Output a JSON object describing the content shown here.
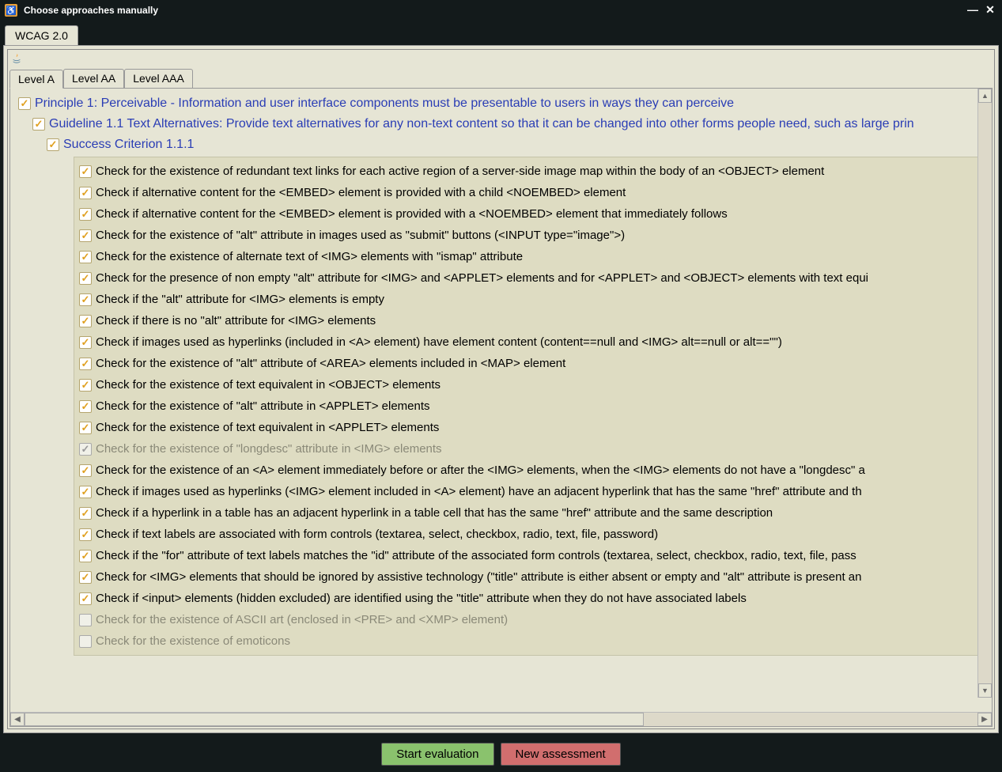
{
  "window": {
    "title": "Choose approaches manually"
  },
  "main_tabs": {
    "active": 0,
    "items": [
      "WCAG 2.0"
    ]
  },
  "level_tabs": {
    "active": 0,
    "items": [
      "Level A",
      "Level AA",
      "Level AAA"
    ]
  },
  "tree": {
    "principle": "Principle 1: Perceivable - Information and user interface components must be presentable to users in ways they can perceive",
    "guideline": "Guideline 1.1 Text Alternatives: Provide text alternatives for any non-text content so that it can be changed into other forms people need, such as large prin",
    "criterion": "Success Criterion 1.1.1",
    "checks": [
      {
        "label": "Check for the existence of redundant text links for each active region of a server-side image map within the body of an <OBJECT> element",
        "checked": true,
        "enabled": true
      },
      {
        "label": "Check if alternative content for the <EMBED> element is provided with a child <NOEMBED> element",
        "checked": true,
        "enabled": true
      },
      {
        "label": "Check if alternative content for the <EMBED> element is provided with a <NOEMBED> element that immediately follows",
        "checked": true,
        "enabled": true
      },
      {
        "label": "Check for the existence of \"alt\" attribute in images used as \"submit\" buttons (<INPUT type=\"image\">)",
        "checked": true,
        "enabled": true
      },
      {
        "label": "Check for the existence of alternate text of <IMG> elements with \"ismap\" attribute",
        "checked": true,
        "enabled": true
      },
      {
        "label": "Check for the presence of non empty \"alt\" attribute for <IMG> and <APPLET> elements and for <APPLET> and <OBJECT> elements with text equi",
        "checked": true,
        "enabled": true
      },
      {
        "label": "Check if the \"alt\" attribute for <IMG> elements is empty",
        "checked": true,
        "enabled": true
      },
      {
        "label": "Check if there is no \"alt\" attribute for <IMG> elements",
        "checked": true,
        "enabled": true
      },
      {
        "label": "Check if images used as hyperlinks (included in <A> element) have element content (content==null and <IMG> alt==null or alt==\"\")",
        "checked": true,
        "enabled": true
      },
      {
        "label": "Check for the existence of \"alt\" attribute of <AREA> elements included in <MAP> element",
        "checked": true,
        "enabled": true
      },
      {
        "label": "Check for the existence of text equivalent in <OBJECT> elements",
        "checked": true,
        "enabled": true
      },
      {
        "label": "Check for the existence of \"alt\" attribute in <APPLET> elements",
        "checked": true,
        "enabled": true
      },
      {
        "label": "Check for the existence of text equivalent in <APPLET> elements",
        "checked": true,
        "enabled": true
      },
      {
        "label": "Check for the existence of \"longdesc\" attribute in <IMG> elements",
        "checked": true,
        "enabled": false
      },
      {
        "label": "Check for the existence of an <A> element immediately before or after the <IMG> elements, when the <IMG> elements do not have a \"longdesc\" a",
        "checked": true,
        "enabled": true
      },
      {
        "label": "Check if images used as hyperlinks (<IMG> element included in <A> element) have an adjacent hyperlink that has the same \"href\" attribute and th",
        "checked": true,
        "enabled": true
      },
      {
        "label": "Check if a hyperlink in a table has an adjacent hyperlink in a table cell that has the same \"href\" attribute and the same description",
        "checked": true,
        "enabled": true
      },
      {
        "label": "Check if text labels are associated with form controls (textarea, select, checkbox, radio, text, file, password)",
        "checked": true,
        "enabled": true
      },
      {
        "label": "Check if the \"for\" attribute of text labels matches the \"id\" attribute of the associated form controls (textarea, select, checkbox, radio, text, file, pass",
        "checked": true,
        "enabled": true
      },
      {
        "label": "Check for <IMG> elements that should be ignored by assistive technology (\"title\" attribute is either absent or empty and \"alt\" attribute is present an",
        "checked": true,
        "enabled": true
      },
      {
        "label": "Check if <input> elements (hidden excluded) are identified using the \"title\" attribute when they do not have associated labels",
        "checked": true,
        "enabled": true
      },
      {
        "label": "Check for the existence of ASCII art (enclosed in <PRE> and <XMP> element)",
        "checked": false,
        "enabled": false
      },
      {
        "label": "Check for the existence of emoticons",
        "checked": false,
        "enabled": false
      }
    ]
  },
  "buttons": {
    "start": "Start evaluation",
    "new": "New assessment"
  }
}
